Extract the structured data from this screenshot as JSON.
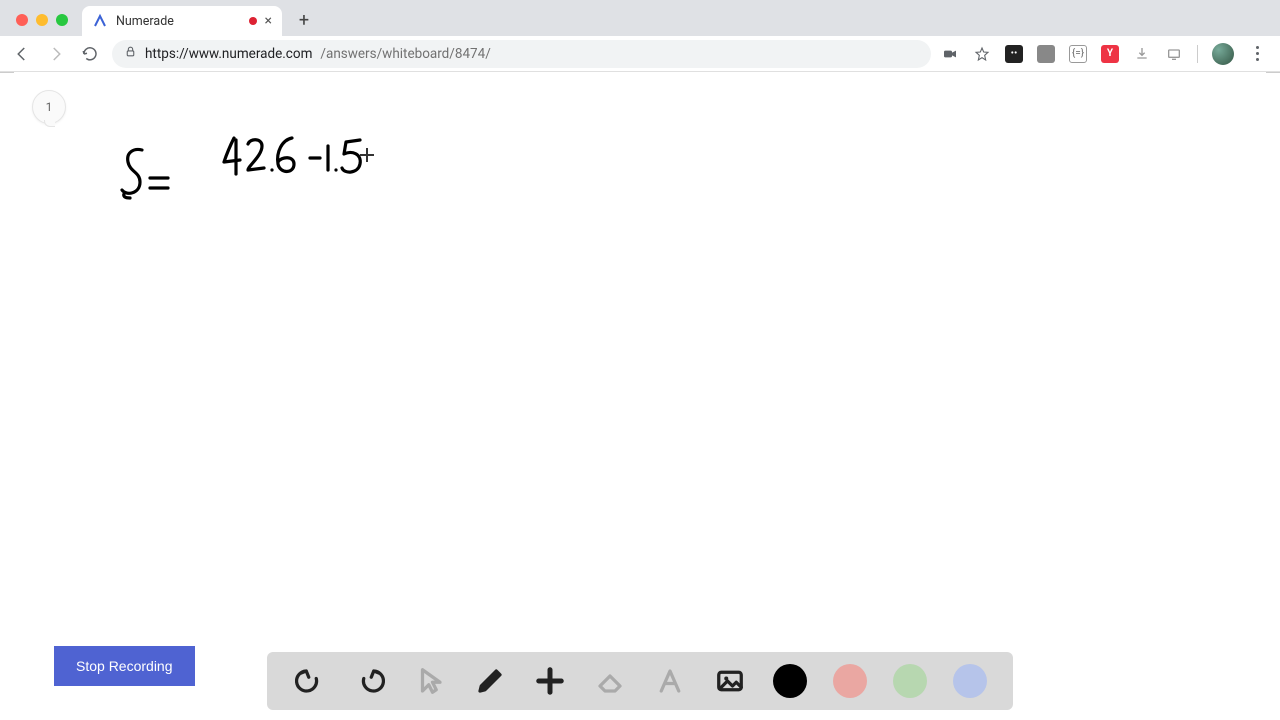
{
  "browser": {
    "tab_title": "Numerade",
    "url_host": "https://www.numerade.com",
    "url_path": "/answers/whiteboard/8474/",
    "traffic": {
      "close": "#ff5f57",
      "min": "#febc2e",
      "max": "#28c840"
    }
  },
  "whiteboard": {
    "page_number": "1",
    "ink_left": "S =",
    "ink_right": "42.6 − 1.5",
    "cursor_symbol": "+"
  },
  "controls": {
    "stop_label": "Stop Recording"
  },
  "toolbar": {
    "undo": "undo",
    "redo": "redo",
    "pointer": "pointer",
    "pen": "pen",
    "add": "add",
    "eraser": "eraser",
    "text": "text",
    "image": "image",
    "colors": {
      "black": "#000000",
      "red": "#eaa7a2",
      "green": "#b7d7b0",
      "blue": "#b6c4ea"
    }
  }
}
